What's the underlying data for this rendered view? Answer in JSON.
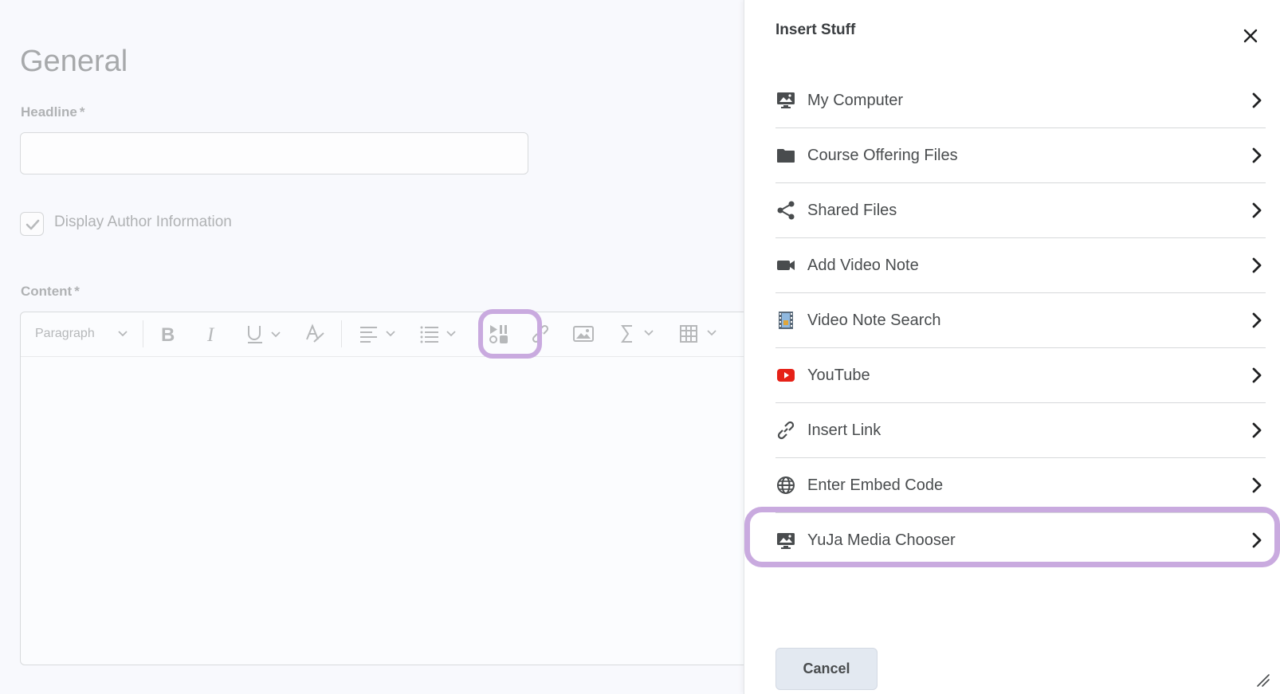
{
  "page": {
    "title": "General",
    "headline_label": "Headline",
    "required_marker": "*",
    "headline_value": "",
    "display_author_label": "Display Author Information",
    "display_author_checked": true,
    "content_label": "Content"
  },
  "editor": {
    "paragraph_format": "Paragraph",
    "tools": [
      "bold-icon",
      "italic-icon",
      "underline-icon",
      "clear-format-icon",
      "align-icon",
      "list-icon",
      "insert-stuff-icon",
      "link-icon",
      "image-icon",
      "equation-icon",
      "table-icon"
    ]
  },
  "dialog": {
    "title": "Insert Stuff",
    "items": [
      {
        "label": "My Computer",
        "icon": "computer-icon"
      },
      {
        "label": "Course Offering Files",
        "icon": "folder-icon"
      },
      {
        "label": "Shared Files",
        "icon": "share-icon"
      },
      {
        "label": "Add Video Note",
        "icon": "video-camera-icon"
      },
      {
        "label": "Video Note Search",
        "icon": "film-icon"
      },
      {
        "label": "YouTube",
        "icon": "youtube-icon"
      },
      {
        "label": "Insert Link",
        "icon": "link-icon"
      },
      {
        "label": "Enter Embed Code",
        "icon": "globe-icon"
      },
      {
        "label": "YuJa Media Chooser",
        "icon": "computer-icon"
      }
    ],
    "cancel_label": "Cancel"
  },
  "colors": {
    "highlight": "#c9aadf",
    "youtube_red": "#e62117",
    "cancel_bg": "#e3e9f1"
  }
}
